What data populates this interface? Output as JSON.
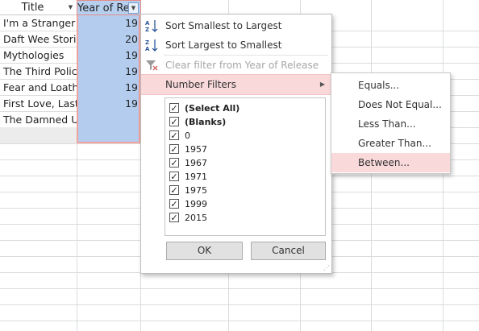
{
  "sheet": {
    "col_title_header": "Title",
    "col_year_header": "Year of Rele",
    "filter_button_glyph": "▼",
    "rows": [
      {
        "title": "I'm a Stranger H",
        "year": "19"
      },
      {
        "title": "Daft Wee Stori",
        "year": "20"
      },
      {
        "title": "Mythologies",
        "year": "19"
      },
      {
        "title": "The Third Polic",
        "year": "19"
      },
      {
        "title": "Fear and Loath",
        "year": "19"
      },
      {
        "title": "First Love, Last",
        "year": "19"
      },
      {
        "title": "The Damned U",
        "year": ""
      }
    ]
  },
  "filter_menu": {
    "sort_asc": {
      "label": "Sort Smallest to Largest",
      "accel": "S",
      "icon": "sort-ascending-icon"
    },
    "sort_desc": {
      "label": "Sort Largest to Smallest",
      "accel": "o",
      "icon": "sort-descending-icon"
    },
    "clear_filter": {
      "label": "Clear filter from Year of Release",
      "accel": "C",
      "icon": "clear-filter-icon",
      "enabled": false
    },
    "number_filters": {
      "label": "Number Filters",
      "accel": "F"
    },
    "values": [
      {
        "label": "(Select All)",
        "checked": true
      },
      {
        "label": "(Blanks)",
        "checked": true
      },
      {
        "label": "0",
        "checked": true
      },
      {
        "label": "1957",
        "checked": true
      },
      {
        "label": "1967",
        "checked": true
      },
      {
        "label": "1971",
        "checked": true
      },
      {
        "label": "1975",
        "checked": true
      },
      {
        "label": "1999",
        "checked": true
      },
      {
        "label": "2015",
        "checked": true
      }
    ],
    "ok_label": "OK",
    "cancel_label": "Cancel"
  },
  "number_filters_submenu": {
    "items": [
      {
        "label": "Equals...",
        "accel": "E"
      },
      {
        "label": "Does Not Equal...",
        "accel": "N"
      },
      {
        "label": "Less Than...",
        "accel": "L"
      },
      {
        "label": "Greater Than...",
        "accel": "G"
      },
      {
        "label": "Between...",
        "accel": "W",
        "highlighted": true
      }
    ]
  },
  "colors": {
    "selection_blue": "#b7cfee",
    "highlight_pink": "#f9d9d9",
    "selection_border": "#e58c86"
  }
}
